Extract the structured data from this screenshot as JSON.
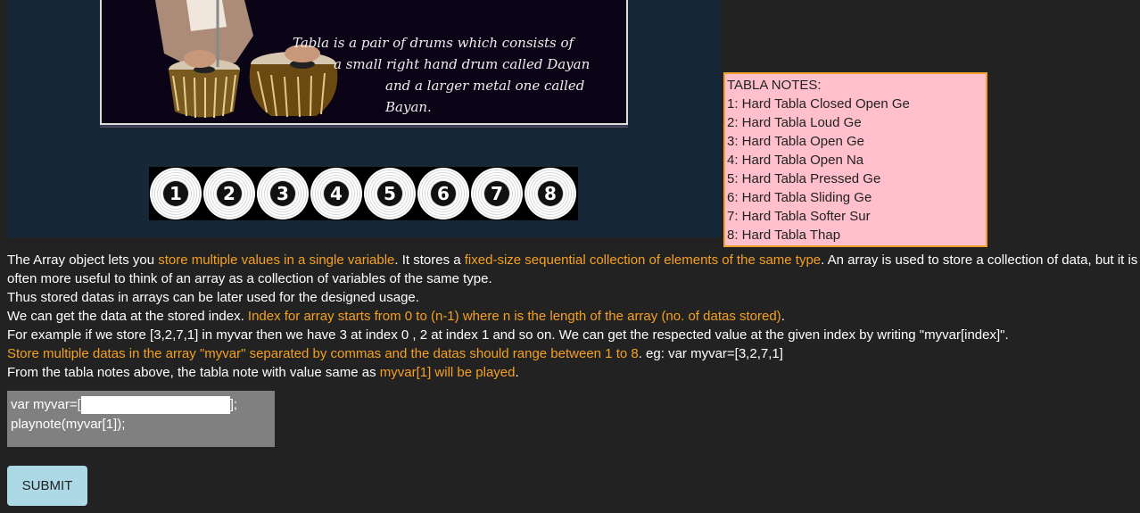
{
  "banner": {
    "caption_lines": [
      "Tabla is a pair of drums which consists of",
      "a small right hand drum called Dayan",
      "and  a larger metal one called Bayan."
    ]
  },
  "pads": [
    {
      "label": "1"
    },
    {
      "label": "2"
    },
    {
      "label": "3"
    },
    {
      "label": "4"
    },
    {
      "label": "5"
    },
    {
      "label": "6"
    },
    {
      "label": "7"
    },
    {
      "label": "8"
    }
  ],
  "notes": {
    "title": "TABLA NOTES:",
    "items": [
      "1: Hard Tabla Closed Open Ge",
      "2: Hard Tabla Loud Ge",
      "3: Hard Tabla Open Ge",
      "4: Hard Tabla Open Na",
      "5: Hard Tabla Pressed Ge",
      "6: Hard Tabla Sliding Ge",
      "7: Hard Tabla Softer Sur",
      "8: Hard Tabla Thap"
    ]
  },
  "description": {
    "p1_a": "The Array object lets you ",
    "p1_b": "store multiple values in a single variable",
    "p1_c": ". It stores a ",
    "p1_d": "fixed-size sequential collection of elements of the same type",
    "p1_e": ". An array is used to store a collection of data, but it is often more useful to think of an array as a collection of variables of the same type.",
    "p2": "Thus stored datas in arrays can be later used for the designed usage.",
    "p3_a": "We can get the data at the stored index. ",
    "p3_b": "Index for array starts from 0 to (n-1) where n is the length of the array (no. of datas stored)",
    "p3_c": ".",
    "p4": "For example if we store [3,2,7,1] in myvar then we have 3 at index 0 , 2 at index 1 and so on. We can get the respected value at the given index by writing \"myvar[index]\".",
    "p5_a": "Store multiple datas in the array \"myvar\" separated by commas and the datas should range between 1 to 8",
    "p5_b": ". eg: var myvar=[3,2,7,1]",
    "p6_a": "From the tabla notes above, the tabla note with value same as ",
    "p6_b": "myvar[1] will be played",
    "p6_c": "."
  },
  "code": {
    "line1_prefix": "var myvar=[",
    "line1_suffix": "];",
    "input_value": "",
    "line2": "playnote(myvar[1]);"
  },
  "submit_label": "SUBMIT"
}
